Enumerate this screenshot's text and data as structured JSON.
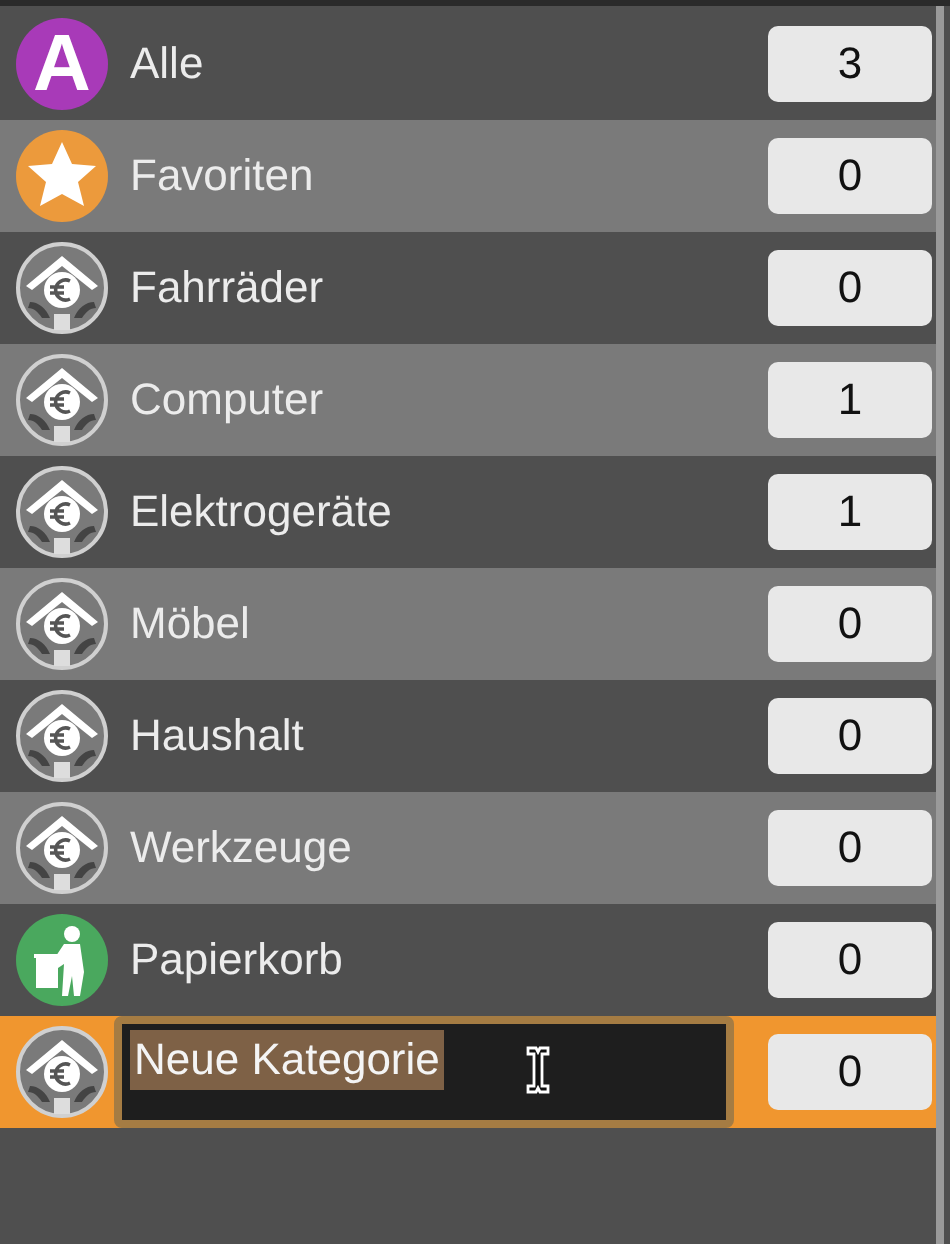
{
  "categories": [
    {
      "label": "Alle",
      "count": "3",
      "kind": "letter",
      "badge": "A",
      "selected": false,
      "editing": false
    },
    {
      "label": "Favoriten",
      "count": "0",
      "kind": "star",
      "selected": false,
      "editing": false
    },
    {
      "label": "Fahrräder",
      "count": "0",
      "kind": "house",
      "selected": false,
      "editing": false
    },
    {
      "label": "Computer",
      "count": "1",
      "kind": "house",
      "selected": false,
      "editing": false
    },
    {
      "label": "Elektrogeräte",
      "count": "1",
      "kind": "house",
      "selected": false,
      "editing": false
    },
    {
      "label": "Möbel",
      "count": "0",
      "kind": "house",
      "selected": false,
      "editing": false
    },
    {
      "label": "Haushalt",
      "count": "0",
      "kind": "house",
      "selected": false,
      "editing": false
    },
    {
      "label": "Werkzeuge",
      "count": "0",
      "kind": "house",
      "selected": false,
      "editing": false
    },
    {
      "label": "Papierkorb",
      "count": "0",
      "kind": "trash",
      "selected": false,
      "editing": false
    },
    {
      "label": "Neue Kategorie",
      "count": "0",
      "kind": "house",
      "selected": true,
      "editing": true
    }
  ]
}
